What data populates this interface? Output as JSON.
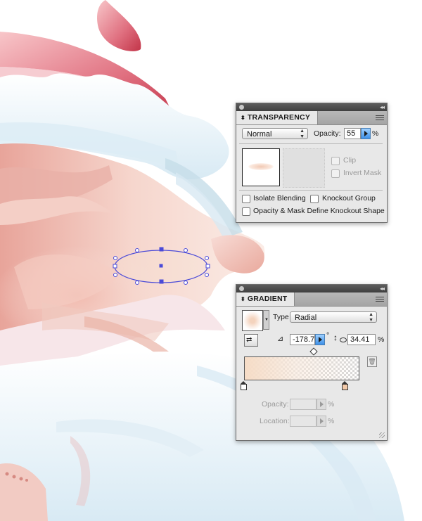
{
  "transparency": {
    "title": "TRANSPARENCY",
    "blend_mode": "Normal",
    "opacity_label": "Opacity:",
    "opacity_value": "55",
    "percent": "%",
    "clip_label": "Clip",
    "invert_mask_label": "Invert Mask",
    "isolate_blending_label": "Isolate Blending",
    "knockout_group_label": "Knockout Group",
    "opacity_mask_label": "Opacity & Mask Define Knockout Shape"
  },
  "gradient": {
    "title": "GRADIENT",
    "type_label": "Type",
    "type_value": "Radial",
    "angle_value": "-178.7",
    "degree_symbol": "°",
    "aspect_value": "34.41",
    "percent": "%",
    "opacity_label": "Opacity:",
    "location_label": "Location:",
    "stop_colors": [
      "#f6dcc6",
      "#ffffff"
    ],
    "selected_stop_color": "#f2c9a8"
  },
  "icons": {
    "panel_close": "close-dot-icon",
    "panel_collapse": "double-chevron-icon",
    "panel_menu": "panel-menu-icon",
    "angle": "angle-icon",
    "aspect": "aspect-ratio-icon",
    "reverse": "reverse-gradient-icon",
    "delete": "trash-icon"
  },
  "colors": {
    "panel_bg": "#e8e8e8",
    "selection_blue": "#4a4ad8",
    "accent_button": "#3c90e8"
  }
}
